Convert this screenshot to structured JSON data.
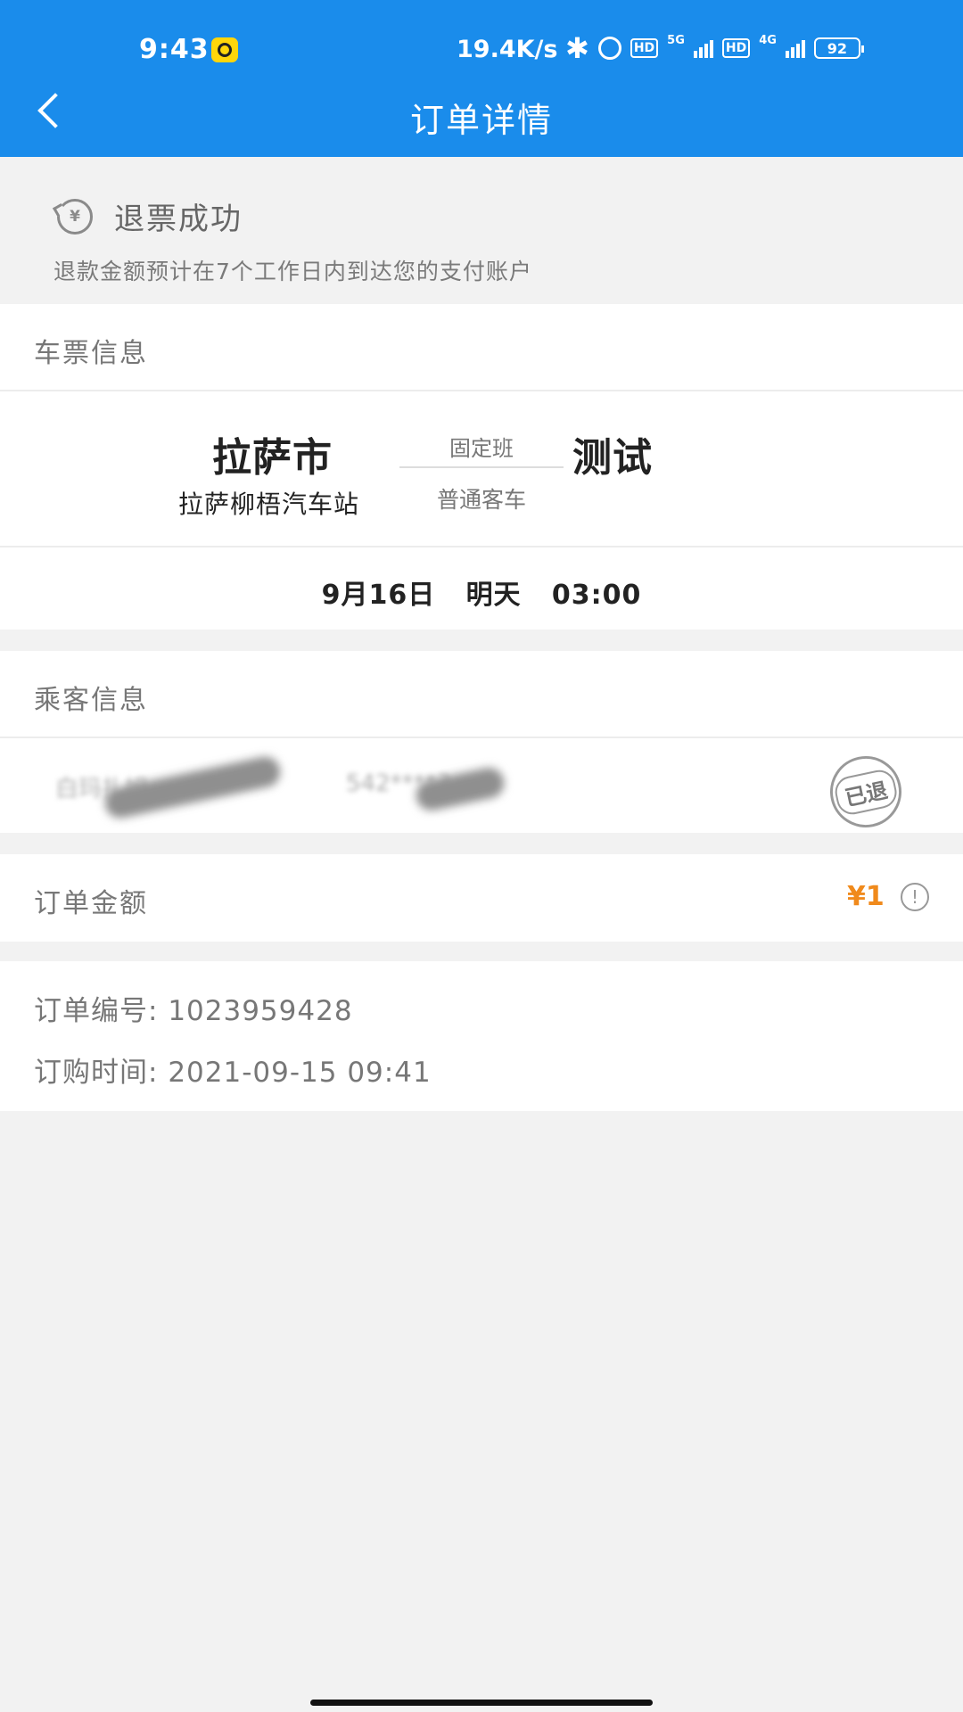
{
  "status_bar": {
    "time": "9:43",
    "net_speed": "19.4K/s",
    "hd1": "HD",
    "net1": "5G",
    "hd2": "HD",
    "net2": "4G",
    "battery": "92"
  },
  "header": {
    "title": "订单详情"
  },
  "refund": {
    "icon_symbol": "¥",
    "title": "退票成功",
    "note": "退款金额预计在7个工作日内到达您的支付账户"
  },
  "ticket": {
    "section_label": "车票信息",
    "from_city": "拉萨市",
    "to_city": "测试",
    "route_type": "固定班",
    "bus_type": "普通客车",
    "station": "拉萨柳梧汽车站",
    "date": "9月16日",
    "day": "明天",
    "time": "03:00"
  },
  "passenger": {
    "section_label": "乘客信息",
    "name_masked": "白玛扎姆",
    "id_masked": "542****3",
    "status": "已退"
  },
  "order_amount": {
    "label": "订单金额",
    "value": "¥1",
    "info_symbol": "!"
  },
  "order_meta": {
    "number_label": "订单编号:",
    "number": "1023959428",
    "time_label": "订购时间:",
    "time": "2021-09-15 09:41"
  },
  "colors": {
    "header_bg": "#1a8ceb",
    "amount": "#f08a1c",
    "page_bg": "#f2f2f2"
  },
  "icons": [
    "back-icon",
    "refund-icon",
    "info-icon",
    "bluetooth-icon",
    "alarm-icon",
    "battery-icon"
  ]
}
